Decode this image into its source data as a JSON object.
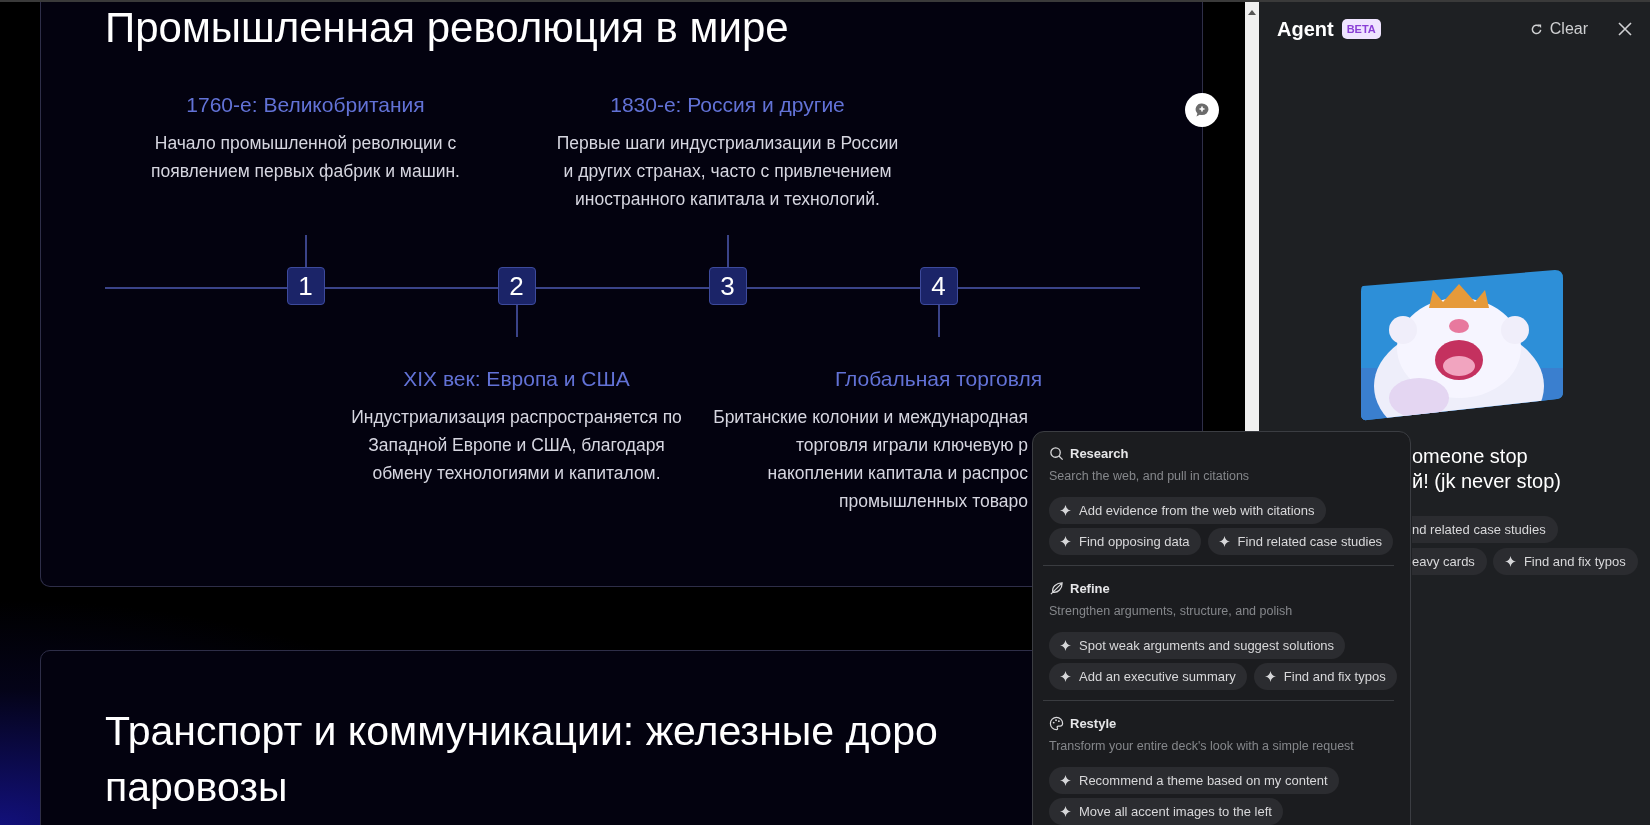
{
  "slides": [
    {
      "title_lines": [
        "Промышленная революция в мире"
      ],
      "timeline": [
        {
          "number": "1",
          "kind": "top",
          "overlapped": false,
          "title": "1760-е: Великобритания",
          "lines": [
            "Начало промышленной революции с",
            "появлением первых фабрик и машин."
          ]
        },
        {
          "number": "2",
          "kind": "bottom",
          "overlapped": false,
          "title": "XIX век: Европа и США",
          "lines": [
            "Индустриализация распространяется по",
            "Западной Европе и США, благодаря",
            "обмену технологиями и капиталом."
          ]
        },
        {
          "number": "3",
          "kind": "top",
          "overlapped": false,
          "title": "1830-е: Россия и другие",
          "lines": [
            "Первые шаги индустриализации в России",
            "и других странах, часто с привлечением",
            "иностранного капитала и технологий."
          ]
        },
        {
          "number": "4",
          "kind": "bottom",
          "overlapped": true,
          "title": "Глобальная торговля",
          "lines": [
            "Британские колонии и международная",
            "торговля играли ключевую р",
            "накоплении капитала и распрос",
            "промышленных товаро"
          ]
        }
      ]
    },
    {
      "title_lines": [
        "Транспорт и коммуникации: железные доро",
        "паровозы"
      ]
    }
  ],
  "agent_panel": {
    "title": "Agent",
    "badge": "BETA",
    "clear": "Clear",
    "message_lines": [
      "omeone stop",
      "й! (jk never stop)"
    ],
    "suggestion_rows": [
      [
        {
          "label": "nd related case studies",
          "icon": false
        }
      ],
      [
        {
          "label": "eavy cards",
          "icon": false
        },
        {
          "label": "Find and fix typos",
          "icon": true
        }
      ]
    ]
  },
  "menu": {
    "sections": [
      {
        "kind": "research",
        "title": "Research",
        "description": "Search the web, and pull in citations",
        "rows": [
          [
            "Add evidence from the web with citations"
          ],
          [
            "Find opposing data",
            "Find related case studies"
          ]
        ]
      },
      {
        "kind": "refine",
        "title": "Refine",
        "description": "Strengthen arguments, structure, and polish",
        "rows": [
          [
            "Spot weak arguments and suggest solutions"
          ],
          [
            "Add an executive summary",
            "Find and fix typos"
          ]
        ]
      },
      {
        "kind": "restyle",
        "title": "Restyle",
        "description": "Transform your entire deck's look with a simple request",
        "rows": [
          [
            "Recommend a theme based on my content"
          ],
          [
            "Move all accent images to the left"
          ]
        ]
      }
    ]
  }
}
